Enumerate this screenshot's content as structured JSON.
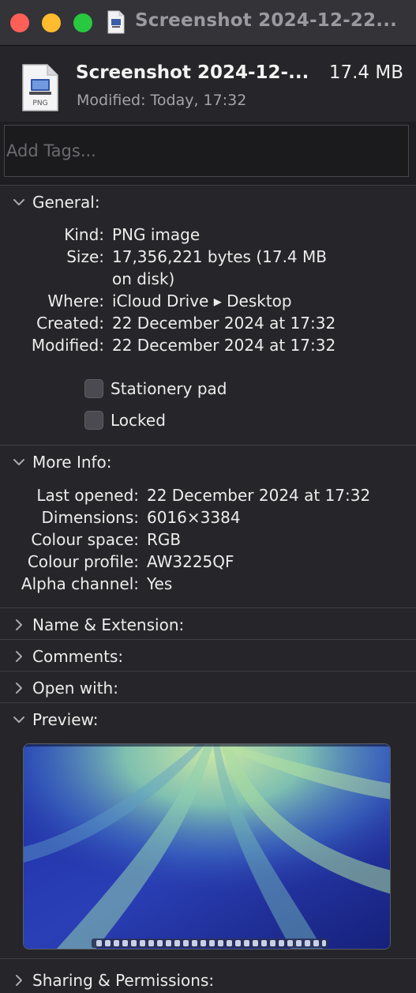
{
  "window": {
    "title": "Screenshot 2024-12-22..."
  },
  "header": {
    "file_name": "Screenshot 2024-12-...",
    "file_size": "17.4 MB",
    "modified": "Modified:  Today, 17:32",
    "file_type_badge": "PNG"
  },
  "tags": {
    "placeholder": "Add Tags..."
  },
  "general": {
    "title": "General:",
    "rows": [
      {
        "label": "Kind:",
        "value": "PNG image"
      },
      {
        "label": "Size:",
        "value": "17,356,221 bytes (17.4 MB",
        "value2": "on disk)"
      },
      {
        "label": "Where:",
        "value": "iCloud Drive ▸ Desktop"
      },
      {
        "label": "Created:",
        "value": "22 December 2024 at 17:32"
      },
      {
        "label": "Modified:",
        "value": "22 December 2024 at 17:32"
      }
    ],
    "checkboxes": [
      {
        "label": "Stationery pad",
        "checked": false
      },
      {
        "label": "Locked",
        "checked": false
      }
    ]
  },
  "more_info": {
    "title": "More Info:",
    "rows": [
      {
        "label": "Last opened:",
        "value": "22 December 2024 at 17:32"
      },
      {
        "label": "Dimensions:",
        "value": "6016×3384"
      },
      {
        "label": "Colour space:",
        "value": "RGB"
      },
      {
        "label": "Colour profile:",
        "value": "AW3225QF"
      },
      {
        "label": "Alpha channel:",
        "value": "Yes"
      }
    ]
  },
  "sections": {
    "name_extension": "Name & Extension:",
    "comments": "Comments:",
    "open_with": "Open with:",
    "preview": "Preview:",
    "sharing": "Sharing & Permissions:"
  },
  "icons": {
    "chevron_down": "chevron-down-icon",
    "chevron_right": "chevron-right-icon",
    "file": "png-file-icon"
  },
  "colors": {
    "close": "#fe5f57",
    "minimize": "#febc2e",
    "zoom": "#28c840",
    "background": "#26262a"
  }
}
